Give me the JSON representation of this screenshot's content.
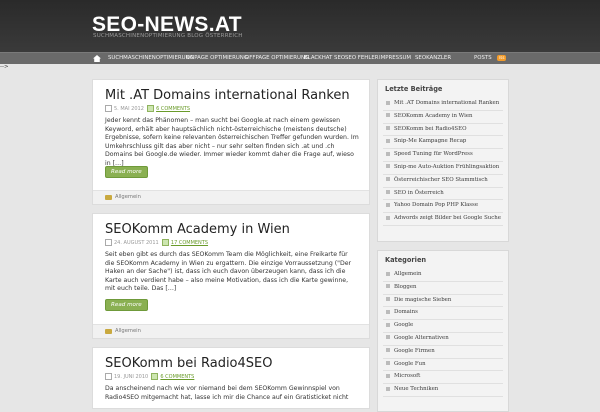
{
  "site": {
    "title": "SEO-NEWS.AT",
    "tagline": "SUCHMASCHINENOPTIMIERUNG BLOG ÖSTERREICH"
  },
  "nav": {
    "items": [
      "SUCHMASCHINENOPTIMIERUNG",
      "ONPAGE OPTIMIERUNG",
      "OFFPAGE OPTIMIERUNG",
      "BLACKHAT SEO",
      "SEO FEHLER",
      "IMPRESSUM",
      "SEOKANZLER"
    ],
    "posts": "POSTS"
  },
  "stray_text": "-->",
  "posts": [
    {
      "title": "Mit .AT Domains international Ranken",
      "date": "5. MAI 2012",
      "comments": "6 COMMENTS",
      "excerpt": "Jeder kennt das Phänomen – man sucht bei Google.at nach einem gewissen Keyword, erhält aber hauptsächlich nicht-österreichische (meistens deutsche) Ergebnisse, sofern keine relevanten österreichischen Treffer gefunden wurden. Im Umkehrschluss gilt das aber nicht – nur sehr selten finden sich .at und .ch Domains bei Google.de wieder. Immer wieder kommt daher die Frage auf, wieso in […]",
      "read_more": "Read more",
      "category": "Allgemein"
    },
    {
      "title": "SEOKomm Academy in Wien",
      "date": "24. AUGUST 2011",
      "comments": "17 COMMENTS",
      "excerpt": "Seit eben gibt es durch das SEOKomm Team die Möglichkeit, eine Freikarte für die SEOKomm Academy in Wien zu ergattern. Die einzige Vorraussetzung (\"Der Haken an der Sache\") ist, dass ich euch davon überzeugen kann, dass ich die Karte auch verdient habe – also meine Motivation, dass ich die Karte gewinne, mit euch teile. Das […]",
      "read_more": "Read more",
      "category": "Allgemein"
    },
    {
      "title": "SEOKomm bei Radio4SEO",
      "date": "19. JUNI 2010",
      "comments": "6 COMMENTS",
      "excerpt": "Da anscheinend nach wie vor niemand bei dem SEOKomm Gewinnspiel von Radio4SEO mitgemacht hat, lasse ich mir die Chance auf ein Gratisticket nicht"
    }
  ],
  "sidebar": {
    "recent_title": "Letzte Beiträge",
    "recent": [
      "Mit .AT Domains international Ranken",
      "SEOKomm Academy in Wien",
      "SEOKomm bei Radio4SEO",
      "Snip-Me Kampagne Recap",
      "Speed Tuning für WordPress",
      "Snip-me Auto-Auktion Frühlingsaktion",
      "Österreichischer SEO Stammtisch",
      "SEO in Österreich",
      "Yahoo Domain Pop PHP Klasse",
      "Adwords zeigt Bilder bei Google Suche"
    ],
    "categories_title": "Kategorien",
    "categories": [
      "Allgemein",
      "Bloggen",
      "Die magische Sieben",
      "Domains",
      "Google",
      "Google Alternativen",
      "Google Firmen",
      "Google Fun",
      "Microsoft",
      "Neue Techniken"
    ]
  },
  "colors": {
    "accent_green": "#8ab052",
    "header_dark": "#2a2a2a",
    "rss": "#f29b2a"
  }
}
